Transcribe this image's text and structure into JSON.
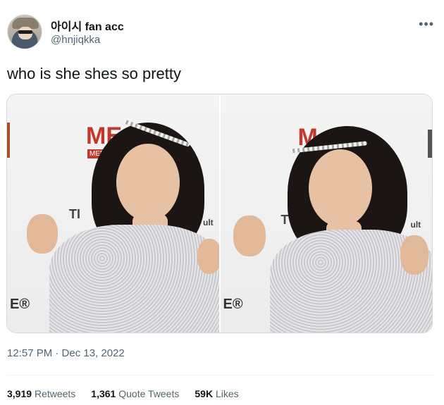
{
  "tweet": {
    "display_name": "아이시 fan acc",
    "handle": "@hnjiqkka",
    "more_icon": "•••",
    "text": "who is she shes so pretty",
    "timestamp": "12:57 PM · Dec 13, 2022",
    "stats": {
      "retweets_count": "3,919",
      "retweets_label": "Retweets",
      "quote_count": "1,361",
      "quote_label": "Quote Tweets",
      "likes_count": "59K",
      "likes_label": "Likes"
    },
    "media": {
      "photo_left": {
        "logo_text": "ME",
        "logo_sub": "MEDI",
        "wall_text": "TI",
        "edge_text": "ult",
        "corner_text": "E®"
      },
      "photo_right": {
        "logo_text": "M",
        "wall_text": "T",
        "edge_text": "ult",
        "corner_text": "E®"
      }
    }
  }
}
